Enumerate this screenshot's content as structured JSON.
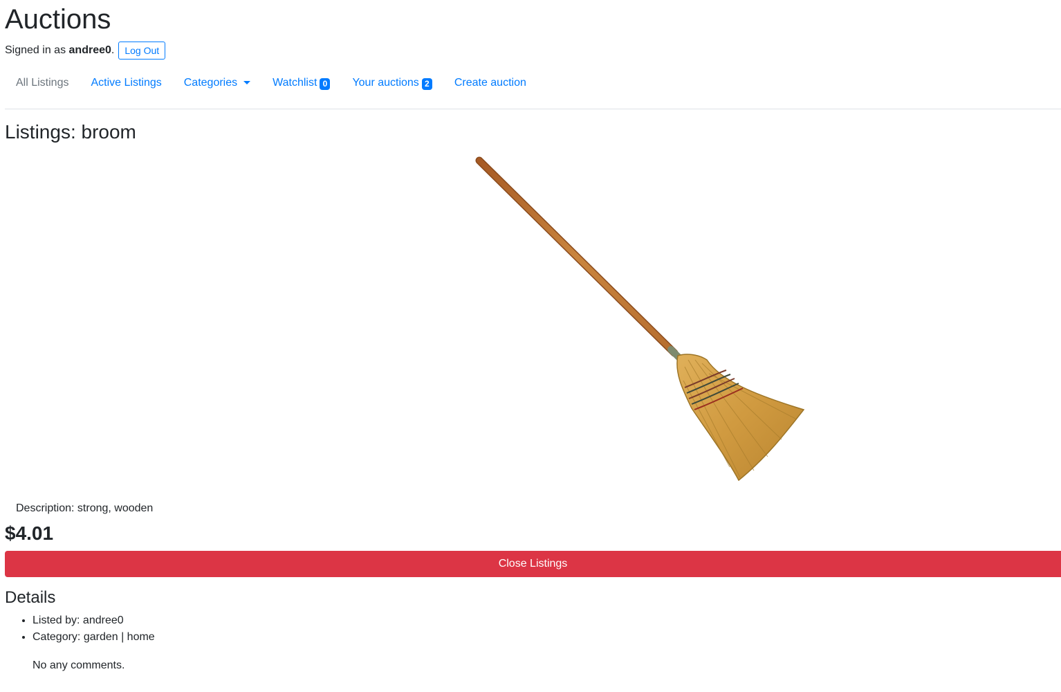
{
  "site": {
    "title": "Auctions"
  },
  "user": {
    "signed_in_prefix": "Signed in as ",
    "username": "andree0",
    "signed_in_suffix": ".",
    "logout_label": "Log Out"
  },
  "nav": {
    "all_listings": "All Listings",
    "active_listings": "Active Listings",
    "categories": "Categories",
    "watchlist": "Watchlist",
    "watchlist_count": "0",
    "your_auctions": "Your auctions",
    "your_auctions_count": "2",
    "create_auction": "Create auction"
  },
  "listing": {
    "title": "Listings: broom",
    "image_icon": "broom-image",
    "description": "Description: strong, wooden",
    "price": "$4.01",
    "close_label": "Close Listings"
  },
  "details": {
    "title": "Details",
    "listed_by": "Listed by: andree0",
    "category": "Category: garden | home",
    "comments": "No any comments."
  },
  "colors": {
    "link": "#007bff",
    "muted": "#6c757d",
    "danger": "#dc3545",
    "text": "#212529"
  }
}
